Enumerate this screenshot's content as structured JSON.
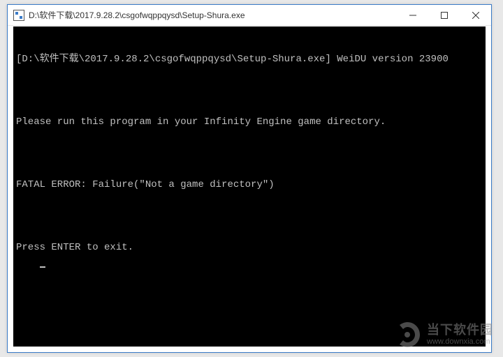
{
  "window": {
    "title": "D:\\软件下载\\2017.9.28.2\\csgofwqppqysd\\Setup-Shura.exe"
  },
  "console": {
    "lines": [
      "[D:\\软件下载\\2017.9.28.2\\csgofwqppqysd\\Setup-Shura.exe] WeiDU version 23900",
      "",
      "Please run this program in your Infinity Engine game directory.",
      "",
      "FATAL ERROR: Failure(\"Not a game directory\")",
      "",
      "Press ENTER to exit."
    ]
  },
  "watermark": {
    "brand": "当下软件园",
    "url": "www.downxia.com"
  }
}
